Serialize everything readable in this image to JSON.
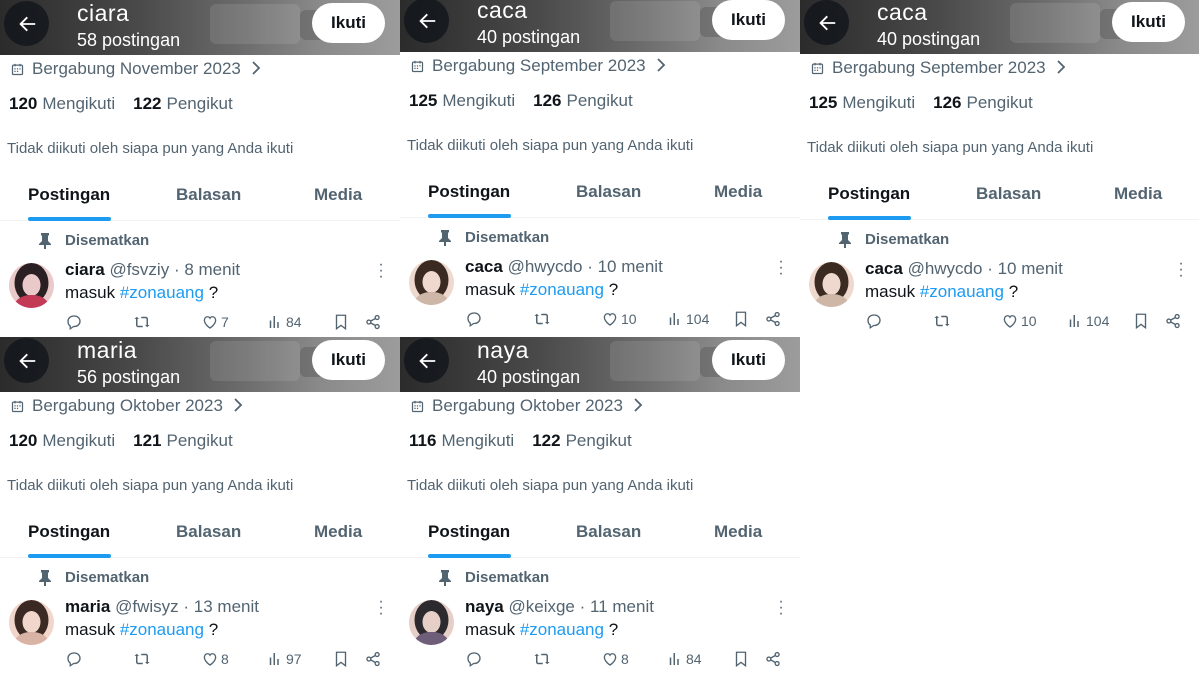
{
  "common": {
    "follow_label": "Ikuti",
    "following_label": "Mengikuti",
    "followers_label": "Pengikut",
    "not_followed_text": "Tidak diikuti oleh siapa pun yang Anda ikuti",
    "tabs": [
      "Postingan",
      "Balasan",
      "Media"
    ],
    "pinned_label": "Disematkan",
    "tweet_text": "masuk",
    "hashtag": "#zonauang",
    "tweet_suffix": "?"
  },
  "profiles": [
    {
      "name": "ciara",
      "posts": "58 postingan",
      "joined": "Bergabung November 2023",
      "following": "120",
      "followers": "122",
      "handle": "@fsvziy",
      "time": "· 8 menit",
      "likes": "7",
      "views": "84",
      "avatar_colors": [
        "#2a1f22",
        "#e9c9c9",
        "#c23a56"
      ]
    },
    {
      "name": "caca",
      "posts": "40 postingan",
      "joined": "Bergabung September 2023",
      "following": "125",
      "followers": "126",
      "handle": "@hwycdo",
      "time": "· 10 menit",
      "likes": "10",
      "views": "104",
      "avatar_colors": [
        "#3a2a22",
        "#efd9cf",
        "#cfb7a8"
      ]
    },
    {
      "name": "caca",
      "posts": "40 postingan",
      "joined": "Bergabung September 2023",
      "following": "125",
      "followers": "126",
      "handle": "@hwycdo",
      "time": "· 10 menit",
      "likes": "10",
      "views": "104",
      "avatar_colors": [
        "#3a2a22",
        "#efd9cf",
        "#cfb7a8"
      ]
    },
    {
      "name": "maria",
      "posts": "56 postingan",
      "joined": "Bergabung Oktober 2023",
      "following": "120",
      "followers": "121",
      "handle": "@fwisyz",
      "time": "· 13 menit",
      "likes": "8",
      "views": "97",
      "avatar_colors": [
        "#3b2a24",
        "#f1d6cc",
        "#d9b3a6"
      ]
    },
    {
      "name": "naya",
      "posts": "40 postingan",
      "joined": "Bergabung Oktober 2023",
      "following": "116",
      "followers": "122",
      "handle": "@keixge",
      "time": "· 11 menit",
      "likes": "8",
      "views": "84",
      "avatar_colors": [
        "#2d2a2f",
        "#e6cfc7",
        "#6f5e7a"
      ]
    }
  ],
  "colors": {
    "accent": "#1d9bf0",
    "muted": "#536471",
    "text": "#0f1419"
  }
}
